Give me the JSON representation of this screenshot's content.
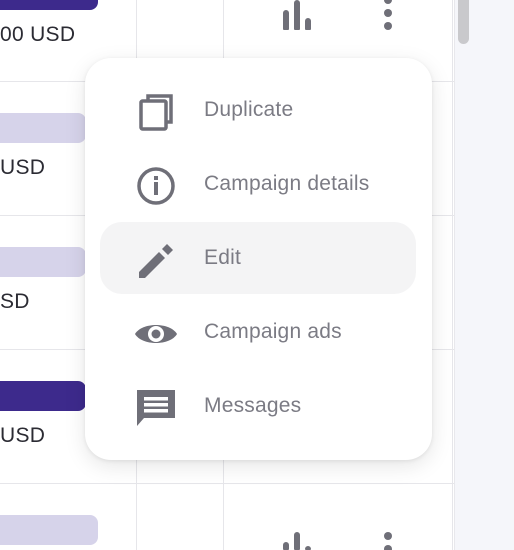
{
  "table": {
    "rows": [
      {
        "budget": "00 USD",
        "bar_style": "dark"
      },
      {
        "budget": "USD",
        "bar_style": "light"
      },
      {
        "budget": "SD",
        "bar_style": "light"
      },
      {
        "budget": "USD",
        "bar_style": "dark"
      },
      {
        "budget": "",
        "bar_style": "light"
      }
    ]
  },
  "menu": {
    "items": [
      {
        "label": "Duplicate",
        "icon": "duplicate-icon"
      },
      {
        "label": "Campaign details",
        "icon": "info-icon"
      },
      {
        "label": "Edit",
        "icon": "edit-pencil-icon",
        "hovered": true
      },
      {
        "label": "Campaign ads",
        "icon": "eye-icon"
      },
      {
        "label": "Messages",
        "icon": "message-icon"
      }
    ]
  },
  "colors": {
    "accent_dark": "#3d2a8c",
    "accent_light": "#d6d3ea",
    "menu_text": "#7b7b84",
    "icon": "#6f6f78"
  }
}
